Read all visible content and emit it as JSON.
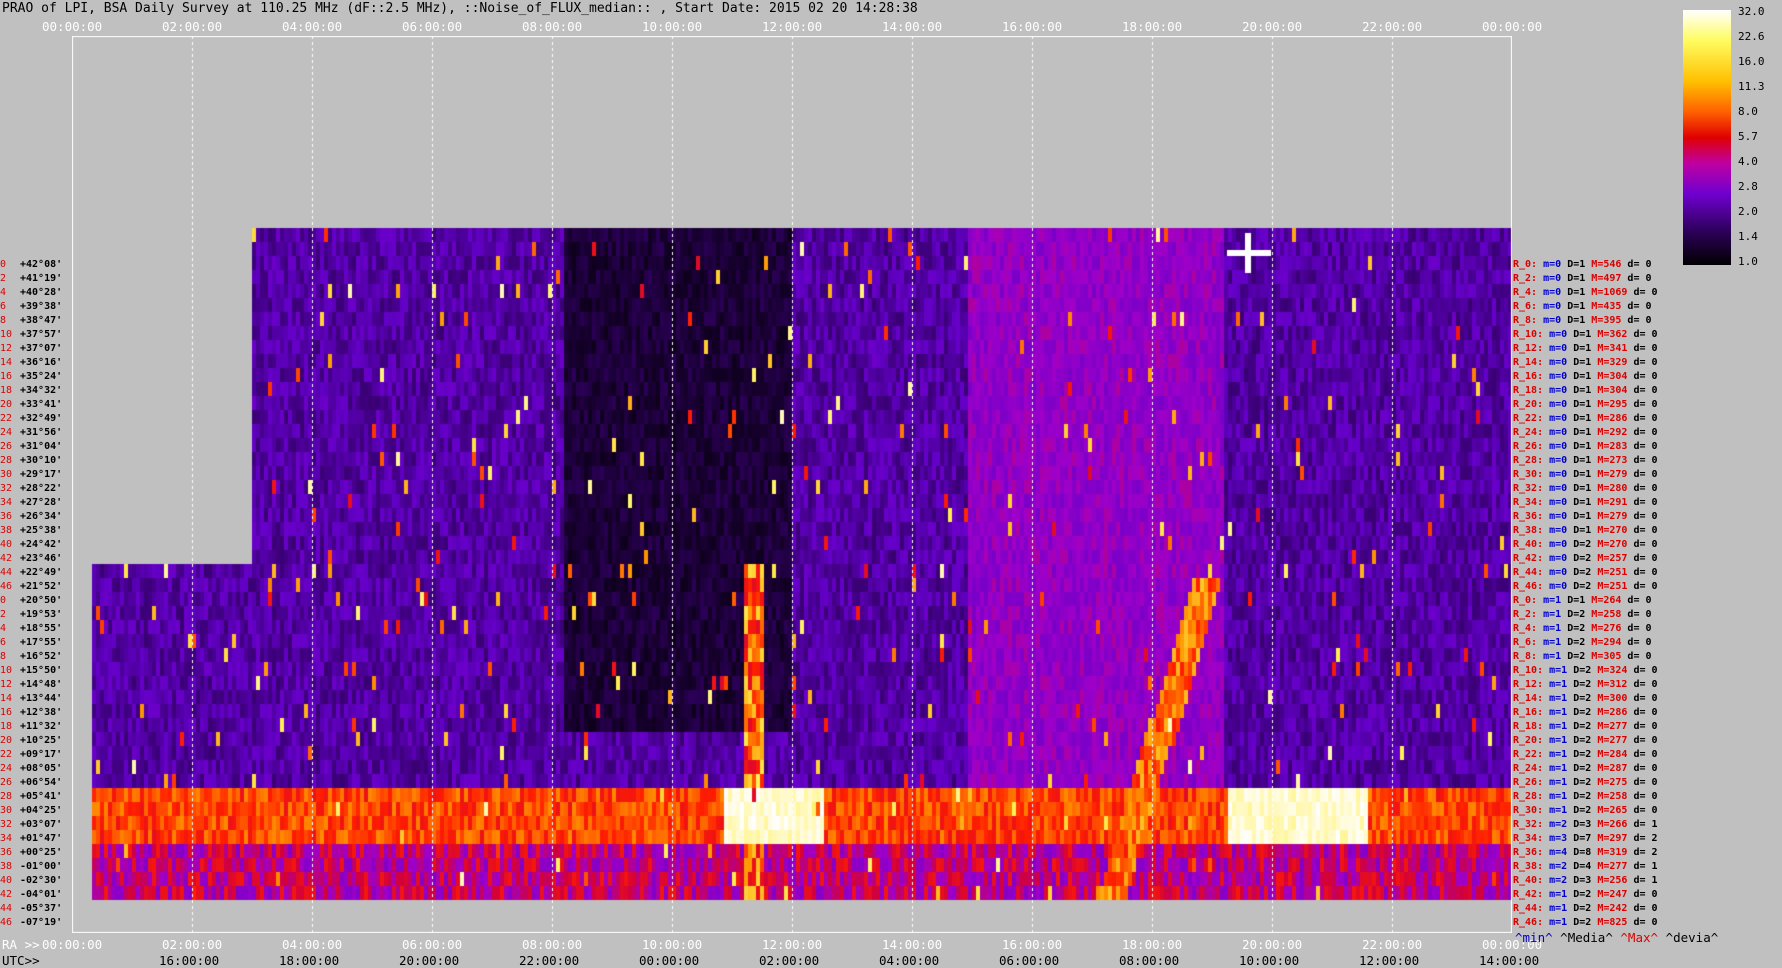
{
  "title": "PRAO of LPI, BSA Daily Survey at 110.25 MHz (dF::2.5 MHz), ::Noise_of_FLUX_median:: , Start Date: 2015 02 20 14:28:38",
  "top_ticks": [
    "00:00:00",
    "02:00:00",
    "04:00:00",
    "06:00:00",
    "08:00:00",
    "10:00:00",
    "12:00:00",
    "14:00:00",
    "16:00:00",
    "18:00:00",
    "20:00:00",
    "22:00:00",
    "00:00:00"
  ],
  "ra_label": "RA >>",
  "ra_ticks": [
    "00:00:00",
    "02:00:00",
    "04:00:00",
    "06:00:00",
    "08:00:00",
    "10:00:00",
    "12:00:00",
    "14:00:00",
    "16:00:00",
    "18:00:00",
    "20:00:00",
    "22:00:00",
    "00:00:00"
  ],
  "utc_label": "UTC>>",
  "utc_ticks": [
    "16:00:00",
    "18:00:00",
    "20:00:00",
    "22:00:00",
    "00:00:00",
    "02:00:00",
    "04:00:00",
    "06:00:00",
    "08:00:00",
    "10:00:00",
    "12:00:00",
    "14:00:00"
  ],
  "rows": [
    {
      "idx": "0",
      "dec": "+42°08'"
    },
    {
      "idx": "2",
      "dec": "+41°19'"
    },
    {
      "idx": "4",
      "dec": "+40°28'"
    },
    {
      "idx": "6",
      "dec": "+39°38'"
    },
    {
      "idx": "8",
      "dec": "+38°47'"
    },
    {
      "idx": "10",
      "dec": "+37°57'"
    },
    {
      "idx": "12",
      "dec": "+37°07'"
    },
    {
      "idx": "14",
      "dec": "+36°16'"
    },
    {
      "idx": "16",
      "dec": "+35°24'"
    },
    {
      "idx": "18",
      "dec": "+34°32'"
    },
    {
      "idx": "20",
      "dec": "+33°41'"
    },
    {
      "idx": "22",
      "dec": "+32°49'"
    },
    {
      "idx": "24",
      "dec": "+31°56'"
    },
    {
      "idx": "26",
      "dec": "+31°04'"
    },
    {
      "idx": "28",
      "dec": "+30°10'"
    },
    {
      "idx": "30",
      "dec": "+29°17'"
    },
    {
      "idx": "32",
      "dec": "+28°22'"
    },
    {
      "idx": "34",
      "dec": "+27°28'"
    },
    {
      "idx": "36",
      "dec": "+26°34'"
    },
    {
      "idx": "38",
      "dec": "+25°38'"
    },
    {
      "idx": "40",
      "dec": "+24°42'"
    },
    {
      "idx": "42",
      "dec": "+23°46'"
    },
    {
      "idx": "44",
      "dec": "+22°49'"
    },
    {
      "idx": "46",
      "dec": "+21°52'"
    },
    {
      "idx": "0",
      "dec": "+20°50'"
    },
    {
      "idx": "2",
      "dec": "+19°53'"
    },
    {
      "idx": "4",
      "dec": "+18°55'"
    },
    {
      "idx": "6",
      "dec": "+17°55'"
    },
    {
      "idx": "8",
      "dec": "+16°52'"
    },
    {
      "idx": "10",
      "dec": "+15°50'"
    },
    {
      "idx": "12",
      "dec": "+14°48'"
    },
    {
      "idx": "14",
      "dec": "+13°44'"
    },
    {
      "idx": "16",
      "dec": "+12°38'"
    },
    {
      "idx": "18",
      "dec": "+11°32'"
    },
    {
      "idx": "20",
      "dec": "+10°25'"
    },
    {
      "idx": "22",
      "dec": "+09°17'"
    },
    {
      "idx": "24",
      "dec": "+08°05'"
    },
    {
      "idx": "26",
      "dec": "+06°54'"
    },
    {
      "idx": "28",
      "dec": "+05°41'"
    },
    {
      "idx": "30",
      "dec": "+04°25'"
    },
    {
      "idx": "32",
      "dec": "+03°07'"
    },
    {
      "idx": "34",
      "dec": "+01°47'"
    },
    {
      "idx": "36",
      "dec": "+00°25'"
    },
    {
      "idx": "38",
      "dec": "-01°00'"
    },
    {
      "idx": "40",
      "dec": "-02°30'"
    },
    {
      "idx": "42",
      "dec": "-04°01'"
    },
    {
      "idx": "44",
      "dec": "-05°37'"
    },
    {
      "idx": "46",
      "dec": "-07°19'"
    }
  ],
  "stats": [
    {
      "r": "R_0:",
      "m": "m=0",
      "d": "D=1",
      "mx": "M=546",
      "dv": "d= 0"
    },
    {
      "r": "R_2:",
      "m": "m=0",
      "d": "D=1",
      "mx": "M=497",
      "dv": "d= 0"
    },
    {
      "r": "R_4:",
      "m": "m=0",
      "d": "D=1",
      "mx": "M=1069",
      "dv": "d= 0"
    },
    {
      "r": "R_6:",
      "m": "m=0",
      "d": "D=1",
      "mx": "M=435",
      "dv": "d= 0"
    },
    {
      "r": "R_8:",
      "m": "m=0",
      "d": "D=1",
      "mx": "M=395",
      "dv": "d= 0"
    },
    {
      "r": "R_10:",
      "m": "m=0",
      "d": "D=1",
      "mx": "M=362",
      "dv": "d= 0"
    },
    {
      "r": "R_12:",
      "m": "m=0",
      "d": "D=1",
      "mx": "M=341",
      "dv": "d= 0"
    },
    {
      "r": "R_14:",
      "m": "m=0",
      "d": "D=1",
      "mx": "M=329",
      "dv": "d= 0"
    },
    {
      "r": "R_16:",
      "m": "m=0",
      "d": "D=1",
      "mx": "M=304",
      "dv": "d= 0"
    },
    {
      "r": "R_18:",
      "m": "m=0",
      "d": "D=1",
      "mx": "M=304",
      "dv": "d= 0"
    },
    {
      "r": "R_20:",
      "m": "m=0",
      "d": "D=1",
      "mx": "M=295",
      "dv": "d= 0"
    },
    {
      "r": "R_22:",
      "m": "m=0",
      "d": "D=1",
      "mx": "M=286",
      "dv": "d= 0"
    },
    {
      "r": "R_24:",
      "m": "m=0",
      "d": "D=1",
      "mx": "M=292",
      "dv": "d= 0"
    },
    {
      "r": "R_26:",
      "m": "m=0",
      "d": "D=1",
      "mx": "M=283",
      "dv": "d= 0"
    },
    {
      "r": "R_28:",
      "m": "m=0",
      "d": "D=1",
      "mx": "M=273",
      "dv": "d= 0"
    },
    {
      "r": "R_30:",
      "m": "m=0",
      "d": "D=1",
      "mx": "M=279",
      "dv": "d= 0"
    },
    {
      "r": "R_32:",
      "m": "m=0",
      "d": "D=1",
      "mx": "M=280",
      "dv": "d= 0"
    },
    {
      "r": "R_34:",
      "m": "m=0",
      "d": "D=1",
      "mx": "M=291",
      "dv": "d= 0"
    },
    {
      "r": "R_36:",
      "m": "m=0",
      "d": "D=1",
      "mx": "M=279",
      "dv": "d= 0"
    },
    {
      "r": "R_38:",
      "m": "m=0",
      "d": "D=1",
      "mx": "M=270",
      "dv": "d= 0"
    },
    {
      "r": "R_40:",
      "m": "m=0",
      "d": "D=2",
      "mx": "M=270",
      "dv": "d= 0"
    },
    {
      "r": "R_42:",
      "m": "m=0",
      "d": "D=2",
      "mx": "M=257",
      "dv": "d= 0"
    },
    {
      "r": "R_44:",
      "m": "m=0",
      "d": "D=2",
      "mx": "M=251",
      "dv": "d= 0"
    },
    {
      "r": "R_46:",
      "m": "m=0",
      "d": "D=2",
      "mx": "M=251",
      "dv": "d= 0"
    },
    {
      "r": "R_0:",
      "m": "m=1",
      "d": "D=1",
      "mx": "M=264",
      "dv": "d= 0"
    },
    {
      "r": "R_2:",
      "m": "m=1",
      "d": "D=2",
      "mx": "M=258",
      "dv": "d= 0"
    },
    {
      "r": "R_4:",
      "m": "m=1",
      "d": "D=2",
      "mx": "M=276",
      "dv": "d= 0"
    },
    {
      "r": "R_6:",
      "m": "m=1",
      "d": "D=2",
      "mx": "M=294",
      "dv": "d= 0"
    },
    {
      "r": "R_8:",
      "m": "m=1",
      "d": "D=2",
      "mx": "M=305",
      "dv": "d= 0"
    },
    {
      "r": "R_10:",
      "m": "m=1",
      "d": "D=2",
      "mx": "M=324",
      "dv": "d= 0"
    },
    {
      "r": "R_12:",
      "m": "m=1",
      "d": "D=2",
      "mx": "M=312",
      "dv": "d= 0"
    },
    {
      "r": "R_14:",
      "m": "m=1",
      "d": "D=2",
      "mx": "M=300",
      "dv": "d= 0"
    },
    {
      "r": "R_16:",
      "m": "m=1",
      "d": "D=2",
      "mx": "M=286",
      "dv": "d= 0"
    },
    {
      "r": "R_18:",
      "m": "m=1",
      "d": "D=2",
      "mx": "M=277",
      "dv": "d= 0"
    },
    {
      "r": "R_20:",
      "m": "m=1",
      "d": "D=2",
      "mx": "M=277",
      "dv": "d= 0"
    },
    {
      "r": "R_22:",
      "m": "m=1",
      "d": "D=2",
      "mx": "M=284",
      "dv": "d= 0"
    },
    {
      "r": "R_24:",
      "m": "m=1",
      "d": "D=2",
      "mx": "M=287",
      "dv": "d= 0"
    },
    {
      "r": "R_26:",
      "m": "m=1",
      "d": "D=2",
      "mx": "M=275",
      "dv": "d= 0"
    },
    {
      "r": "R_28:",
      "m": "m=1",
      "d": "D=2",
      "mx": "M=258",
      "dv": "d= 0"
    },
    {
      "r": "R_30:",
      "m": "m=1",
      "d": "D=2",
      "mx": "M=265",
      "dv": "d= 0"
    },
    {
      "r": "R_32:",
      "m": "m=2",
      "d": "D=3",
      "mx": "M=266",
      "dv": "d= 1"
    },
    {
      "r": "R_34:",
      "m": "m=3",
      "d": "D=7",
      "mx": "M=297",
      "dv": "d= 2"
    },
    {
      "r": "R_36:",
      "m": "m=4",
      "d": "D=8",
      "mx": "M=319",
      "dv": "d= 2"
    },
    {
      "r": "R_38:",
      "m": "m=2",
      "d": "D=4",
      "mx": "M=277",
      "dv": "d= 1"
    },
    {
      "r": "R_40:",
      "m": "m=2",
      "d": "D=3",
      "mx": "M=256",
      "dv": "d= 1"
    },
    {
      "r": "R_42:",
      "m": "m=1",
      "d": "D=2",
      "mx": "M=247",
      "dv": "d= 0"
    },
    {
      "r": "R_44:",
      "m": "m=1",
      "d": "D=2",
      "mx": "M=242",
      "dv": "d= 0"
    },
    {
      "r": "R_46:",
      "m": "m=1",
      "d": "D=2",
      "mx": "M=825",
      "dv": "d= 0"
    }
  ],
  "legend_bottom": {
    "min": "^min^",
    "media": "^Media^",
    "max": "^Max^",
    "devia": "^devia^"
  },
  "colorbar": {
    "ticks": [
      "32.0",
      "22.6",
      "16.0",
      "11.3",
      "8.0",
      "5.7",
      "4.0",
      "2.8",
      "2.0",
      "1.4",
      "1.0"
    ]
  },
  "chart_data": {
    "type": "heatmap",
    "title": "PRAO of LPI, BSA Daily Survey at 110.25 MHz (dF::2.5 MHz), ::Noise_of_FLUX_median:: , Start Date: 2015 02 20 14:28:38",
    "x_axis": "RA 00:00:00 to 24:00:00 (UTC 14:28 to 14:28 next day)",
    "y_axis": "Declination rows +42°08' to -07°19'",
    "color_scale": {
      "min": 1.0,
      "max": 32.0,
      "scale": "log"
    },
    "notable_features": [
      {
        "ra": "20:00",
        "dec": "+40°28'",
        "value": 32.0
      },
      {
        "ra": "11:40-13:30",
        "dec": "+01°47' to -01°00'",
        "value": 32.0
      },
      {
        "ra": "21:30-23:00",
        "dec": "+01°47' to -01°00'",
        "value": 32.0
      },
      {
        "ra": "00:30-02:30",
        "dec": "+00°25'",
        "value": 16.0
      },
      {
        "ra": "18:30-20:00",
        "dec": "+16°52' to -07°19'",
        "value": 8.0
      }
    ]
  },
  "colors": {
    "background": "#c0c0c0",
    "accent_red": "#dd0000",
    "tick_white": "#ffffff"
  }
}
